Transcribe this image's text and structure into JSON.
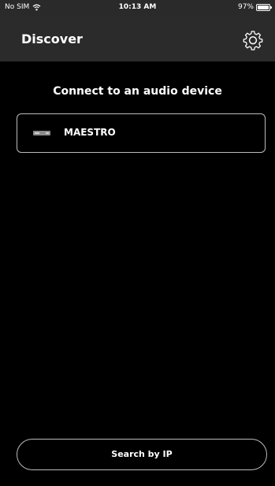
{
  "status": {
    "carrier": "No SIM",
    "time": "10:13 AM",
    "battery": "97%",
    "battery_level": 0.97
  },
  "nav": {
    "title": "Discover",
    "settings_icon": "gear-icon"
  },
  "main": {
    "heading": "Connect to an audio device",
    "devices": [
      {
        "name": "MAESTRO",
        "icon": "audio-device-icon"
      }
    ],
    "search_button": "Search by IP"
  }
}
